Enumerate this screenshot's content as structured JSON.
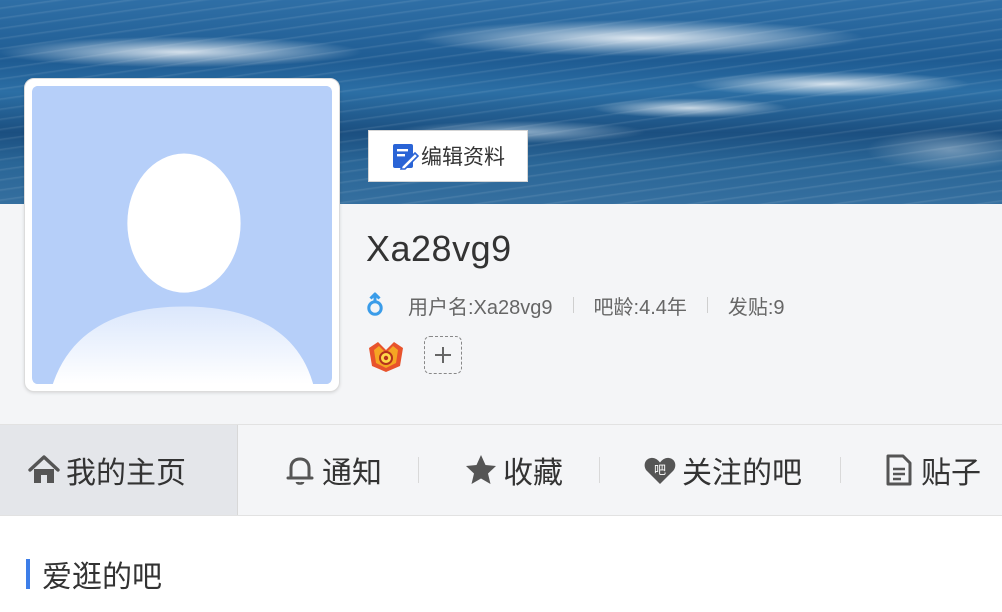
{
  "banner": {
    "icon": "ocean-cover-image"
  },
  "avatar": {
    "icon": "default-avatar-silhouette"
  },
  "edit_button": {
    "label": "编辑资料",
    "icon": "edit-profile-icon"
  },
  "profile": {
    "name": "Xa28vg9",
    "gender_icon": "male-gender-icon",
    "username": "用户名:Xa28vg9",
    "bar_age": "吧龄:4.4年",
    "posts": "发贴:9"
  },
  "badges": {
    "badge_icon": "king-glory-badge-icon",
    "add_icon": "plus-icon"
  },
  "tabs": [
    {
      "label": "我的主页",
      "icon": "home-icon",
      "active": true
    },
    {
      "label": "通知",
      "icon": "bell-icon"
    },
    {
      "label": "收藏",
      "icon": "star-icon"
    },
    {
      "label": "关注的吧",
      "icon": "heart-ba-icon"
    },
    {
      "label": "贴子",
      "icon": "document-icon"
    }
  ],
  "section": {
    "title": "爱逛的吧"
  },
  "colors": {
    "accent": "#3d7ee8",
    "tab_active_bg": "#e4e6ea",
    "avatar_bg": "#b6cff9",
    "gender_blue": "#3a9ce9"
  }
}
